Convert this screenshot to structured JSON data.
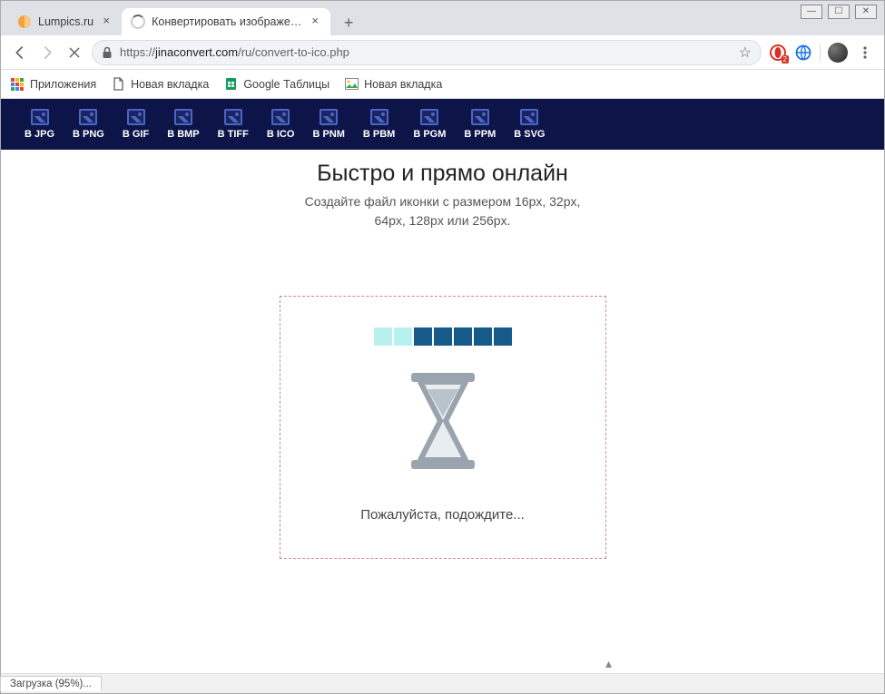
{
  "window_controls": {
    "min": "—",
    "max": "☐",
    "close": "✕"
  },
  "tabs": [
    {
      "title": "Lumpics.ru",
      "active": false
    },
    {
      "title": "Конвертировать изображения",
      "active": true,
      "loading": true
    }
  ],
  "newtab_glyph": "+",
  "toolbar": {
    "url_scheme": "https://",
    "url_host": "jinaconvert.com",
    "url_path": "/ru/convert-to-ico.php",
    "opera_badge": "2"
  },
  "bookmarks": {
    "apps": "Приложения",
    "items": [
      {
        "label": "Новая вкладка",
        "icon": "page"
      },
      {
        "label": "Google Таблицы",
        "icon": "sheets"
      },
      {
        "label": "Новая вкладка",
        "icon": "picture"
      }
    ]
  },
  "formats": [
    "В JPG",
    "В PNG",
    "В GIF",
    "В BMP",
    "В TIFF",
    "В ICO",
    "В PNM",
    "В PBM",
    "В PGM",
    "В PPM",
    "В SVG"
  ],
  "headline": "Быстро и прямо онлайн",
  "subline1": "Создайте файл иконки с размером 16px, 32px,",
  "subline2": "64px, 128px или 256px.",
  "wait_text": "Пожалуйста, подождите...",
  "status_text": "Загрузка (95%)...",
  "progress_cells": [
    "faded",
    "faded",
    "full",
    "full",
    "full",
    "full",
    "full"
  ]
}
